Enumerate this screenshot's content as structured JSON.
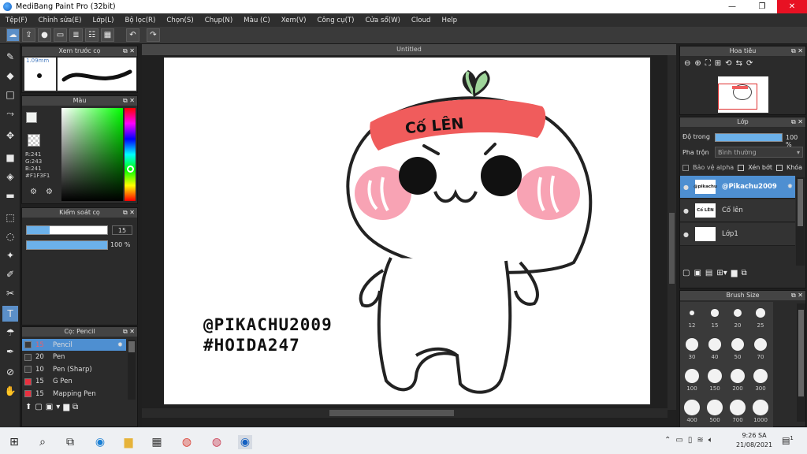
{
  "window": {
    "title": "MediBang Paint Pro (32bit)",
    "min": "—",
    "max": "❐",
    "close": "✕"
  },
  "menu": [
    "Tệp(F)",
    "Chỉnh sửa(E)",
    "Lớp(L)",
    "Bộ lọc(R)",
    "Chọn(S)",
    "Chụp(N)",
    "Màu (C)",
    "Xem(V)",
    "Công cụ(T)",
    "Cửa sổ(W)",
    "Cloud",
    "Help"
  ],
  "brush_preview": {
    "title": "Xem trước cọ",
    "size": "1.09mm"
  },
  "color_panel": {
    "title": "Màu",
    "r": "R:241",
    "g": "G:243",
    "b": "B:241",
    "hex": "#F1F3F1",
    "fg_color": "#f1f3f1",
    "accent": "#e8303f"
  },
  "brush_control": {
    "title": "Kiểm soát cọ",
    "size_value": "15",
    "opacity_value": "100 %",
    "size_fraction": 0.28,
    "opacity_fraction": 1.0
  },
  "brush_list": {
    "title": "Cọ: Pencil",
    "items": [
      {
        "size": "15",
        "name": "Pencil",
        "color": "#3a3a3a"
      },
      {
        "size": "20",
        "name": "Pen",
        "color": "#3a3a3a"
      },
      {
        "size": "10",
        "name": "Pen (Sharp)",
        "color": "#3a3a3a"
      },
      {
        "size": "15",
        "name": "G Pen",
        "color": "#e8303f"
      },
      {
        "size": "15",
        "name": "Mapping Pen",
        "color": "#e8303f"
      }
    ]
  },
  "canvas": {
    "tab": "Untitled",
    "headband_text": "Cố LÊN",
    "watermark_line1": "@PIKACHU2009",
    "watermark_line2": "#HOIDA247"
  },
  "navigator": {
    "title": "Hoa tiêu"
  },
  "layers": {
    "title": "Lớp",
    "opacity_label": "Độ trong",
    "opacity_value": "100 %",
    "blend_label": "Pha trộn",
    "blend_value": "Bình thường",
    "protect_alpha": "Bảo vệ alpha",
    "clip": "Xén bớt",
    "lock": "Khóa",
    "items": [
      {
        "name": "@Pikachu2009",
        "thumb": "@pikachu",
        "selected": true
      },
      {
        "name": "Cố lên",
        "thumb": "Cố LÊN",
        "selected": false
      },
      {
        "name": "Lớp1",
        "thumb": "",
        "selected": false
      }
    ]
  },
  "brush_size": {
    "title": "Brush Size",
    "sizes": [
      "12",
      "15",
      "20",
      "25",
      "30",
      "40",
      "50",
      "70",
      "100",
      "150",
      "200",
      "300",
      "400",
      "500",
      "700",
      "1000"
    ]
  },
  "taskbar": {
    "time": "9:26 SA",
    "date": "21/08/2021",
    "notif": "1"
  }
}
